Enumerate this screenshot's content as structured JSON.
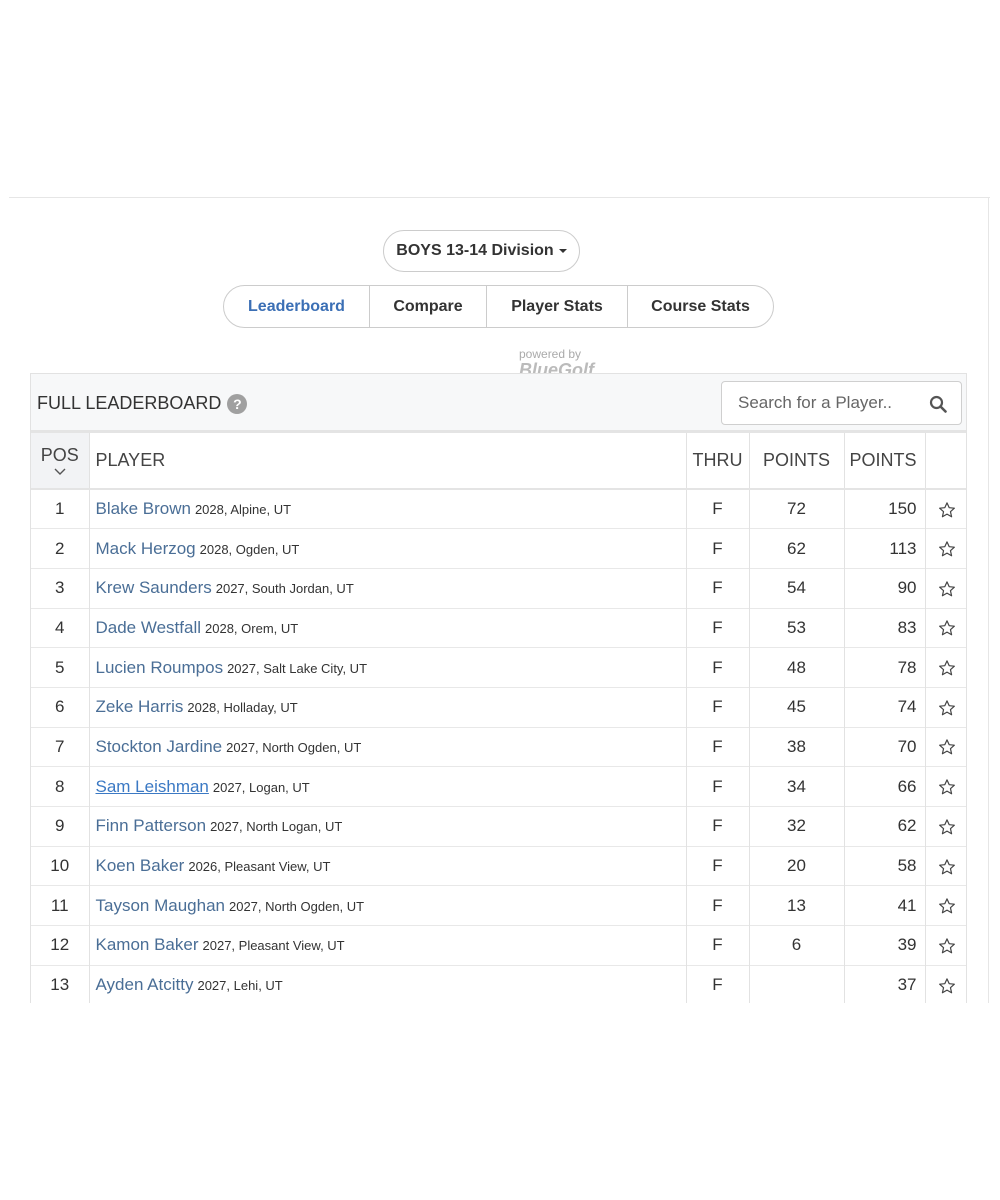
{
  "division": {
    "label": "BOYS 13-14 Division"
  },
  "tabs": [
    {
      "label": "Leaderboard",
      "active": true
    },
    {
      "label": "Compare",
      "active": false
    },
    {
      "label": "Player Stats",
      "active": false
    },
    {
      "label": "Course Stats",
      "active": false
    }
  ],
  "powered_by": {
    "small": "powered by",
    "logo": "BlueGolf"
  },
  "leaderboard": {
    "title": "FULL LEADERBOARD",
    "help_icon": "question-circle-icon",
    "search": {
      "placeholder": "Search for a Player..",
      "value": ""
    },
    "columns": {
      "pos": "POS",
      "player": "PLAYER",
      "thru": "THRU",
      "points": "POINTS",
      "total_points": "POINTS"
    },
    "rows": [
      {
        "pos": "1",
        "name": "Blake Brown",
        "meta": "2028, Alpine, UT",
        "thru": "F",
        "points": "72",
        "total": "150"
      },
      {
        "pos": "2",
        "name": "Mack Herzog",
        "meta": "2028, Ogden, UT",
        "thru": "F",
        "points": "62",
        "total": "113"
      },
      {
        "pos": "3",
        "name": "Krew Saunders",
        "meta": "2027, South Jordan, UT",
        "thru": "F",
        "points": "54",
        "total": "90"
      },
      {
        "pos": "4",
        "name": "Dade Westfall",
        "meta": "2028, Orem, UT",
        "thru": "F",
        "points": "53",
        "total": "83"
      },
      {
        "pos": "5",
        "name": "Lucien Roumpos",
        "meta": "2027, Salt Lake City, UT",
        "thru": "F",
        "points": "48",
        "total": "78"
      },
      {
        "pos": "6",
        "name": "Zeke Harris",
        "meta": "2028, Holladay, UT",
        "thru": "F",
        "points": "45",
        "total": "74"
      },
      {
        "pos": "7",
        "name": "Stockton Jardine",
        "meta": "2027, North Ogden, UT",
        "thru": "F",
        "points": "38",
        "total": "70"
      },
      {
        "pos": "8",
        "name": "Sam Leishman",
        "meta": "2027, Logan, UT",
        "thru": "F",
        "points": "34",
        "total": "66",
        "hovered": true
      },
      {
        "pos": "9",
        "name": "Finn Patterson",
        "meta": "2027, North Logan, UT",
        "thru": "F",
        "points": "32",
        "total": "62"
      },
      {
        "pos": "10",
        "name": "Koen Baker",
        "meta": "2026, Pleasant View, UT",
        "thru": "F",
        "points": "20",
        "total": "58"
      },
      {
        "pos": "11",
        "name": "Tayson Maughan",
        "meta": "2027, North Ogden, UT",
        "thru": "F",
        "points": "13",
        "total": "41"
      },
      {
        "pos": "12",
        "name": "Kamon Baker",
        "meta": "2027, Pleasant View, UT",
        "thru": "F",
        "points": "6",
        "total": "39"
      },
      {
        "pos": "13",
        "name": "Ayden Atcitty",
        "meta": "2027, Lehi, UT",
        "thru": "F",
        "points": "",
        "total": "37"
      }
    ]
  },
  "colors": {
    "accent": "#3b6fb5",
    "player_name": "#4a6e96",
    "header_bg": "#f7f8f9"
  }
}
